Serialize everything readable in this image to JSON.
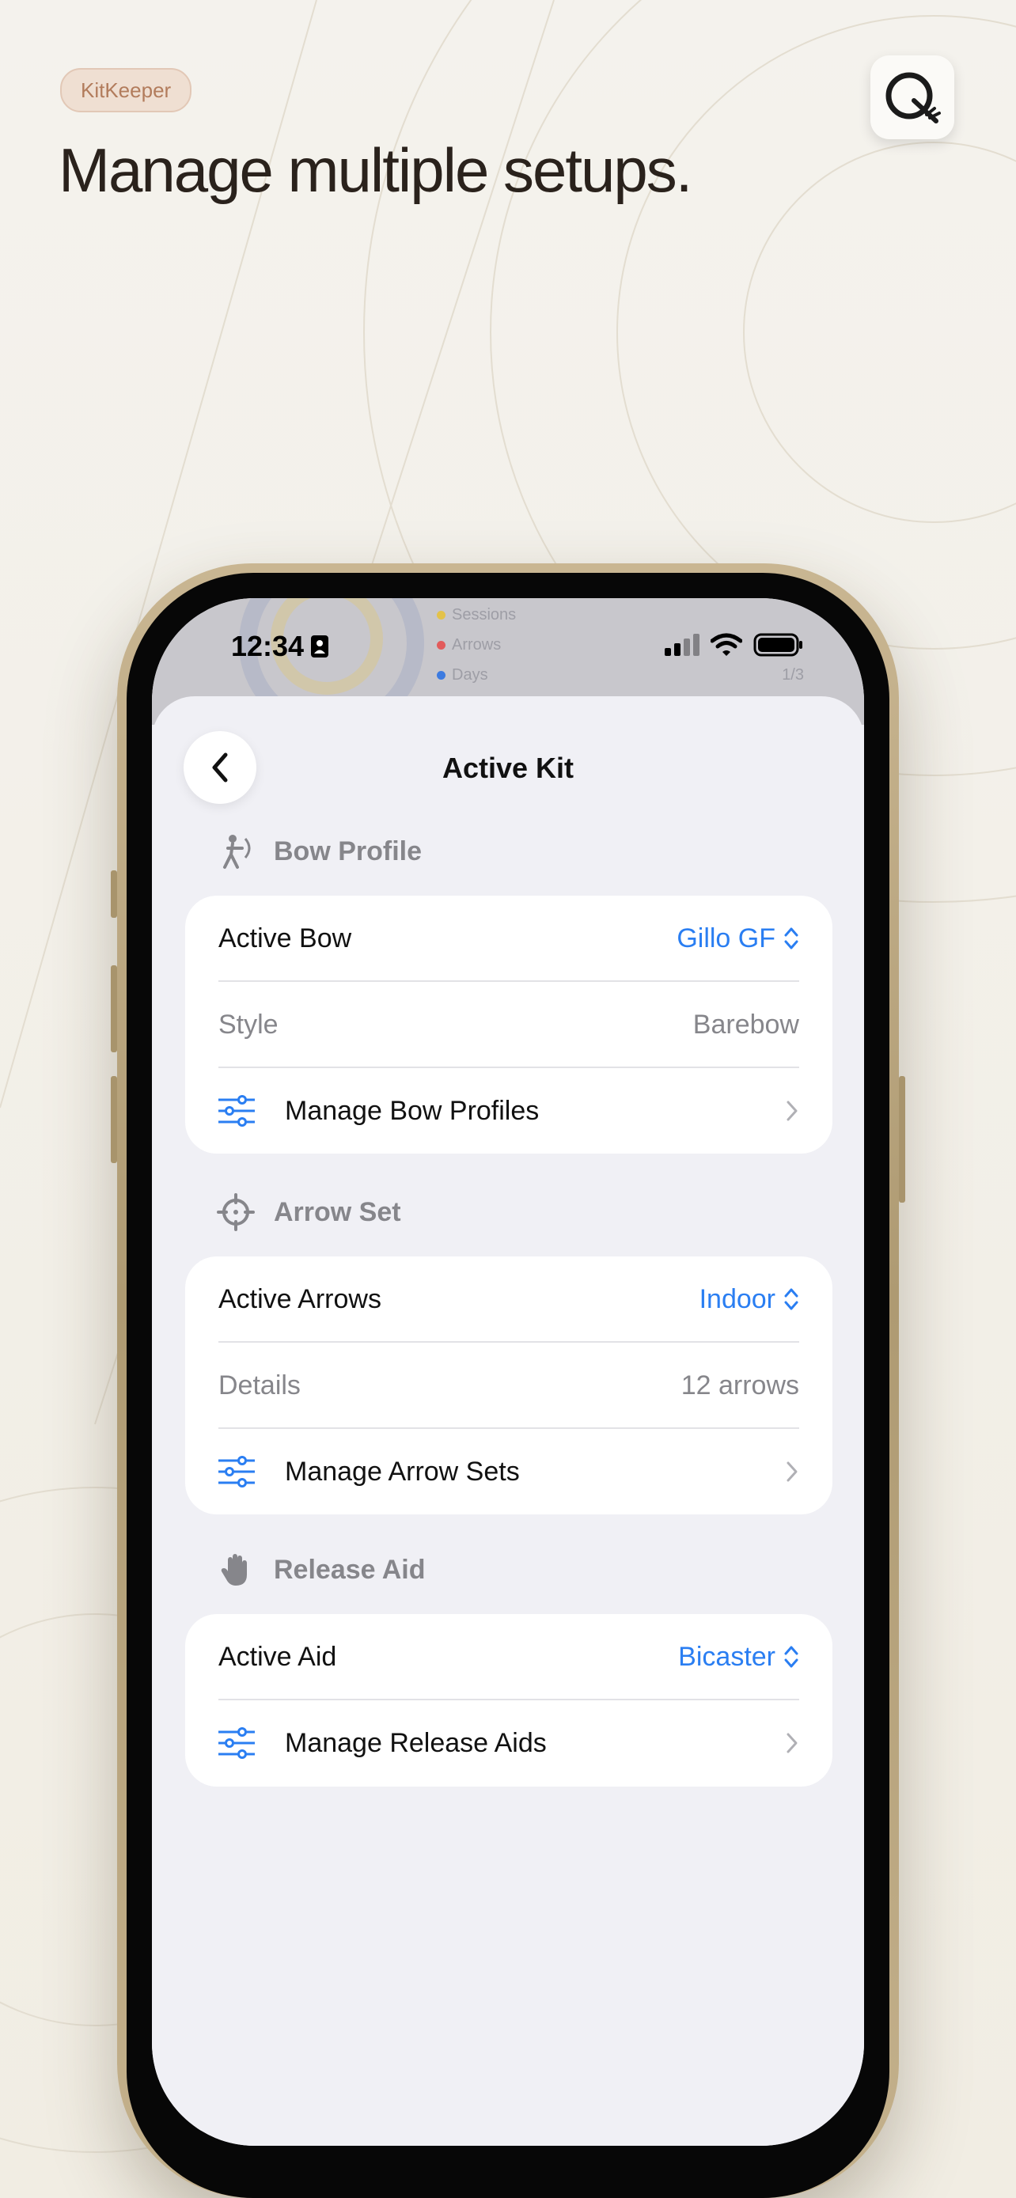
{
  "badge": "KitKeeper",
  "headline": "Manage multiple setups.",
  "status_bar": {
    "time": "12:34"
  },
  "background_card": {
    "rows": [
      {
        "label": "Sessions",
        "color": "#e3c24a",
        "value": ""
      },
      {
        "label": "Arrows",
        "color": "#e25b5b",
        "value": ""
      },
      {
        "label": "Days",
        "color": "#3d7be0",
        "value": "1/3"
      }
    ]
  },
  "sheet": {
    "title": "Active Kit",
    "sections": [
      {
        "title": "Bow Profile",
        "icon": "archer-icon",
        "active_label": "Active Bow",
        "active_value": "Gillo GF",
        "detail_label": "Style",
        "detail_value": "Barebow",
        "manage_label": "Manage Bow Profiles"
      },
      {
        "title": "Arrow Set",
        "icon": "crosshair-icon",
        "active_label": "Active Arrows",
        "active_value": "Indoor",
        "detail_label": "Details",
        "detail_value": "12 arrows",
        "manage_label": "Manage Arrow Sets"
      },
      {
        "title": "Release Aid",
        "icon": "hand-icon",
        "active_label": "Active Aid",
        "active_value": "Bicaster",
        "manage_label": "Manage Release Aids"
      }
    ]
  },
  "colors": {
    "accent": "#2a7ef2",
    "muted": "#86868b",
    "frame": "#b9a67e"
  }
}
